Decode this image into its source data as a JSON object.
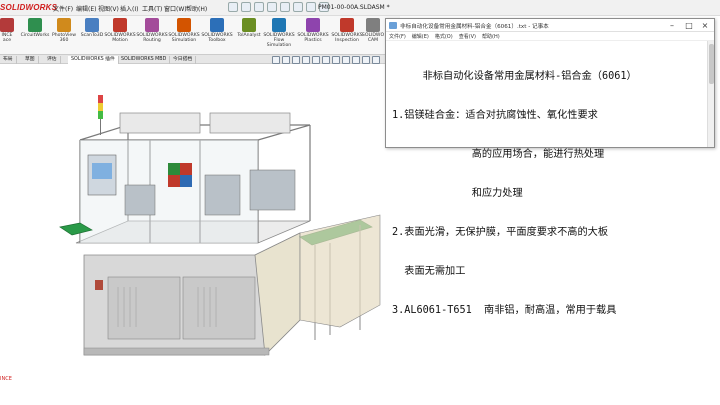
{
  "app": {
    "logo": "SOLIDWORKS",
    "document_title": "PM01-00-00A.SLDASM *"
  },
  "menu": [
    "文件(F)",
    "编辑(E)",
    "视图(V)",
    "插入(I)",
    "工具(T)",
    "窗口(W)",
    "帮助(H)"
  ],
  "tools": [
    {
      "label": "INCE\nace",
      "color": "#b33a3a"
    },
    {
      "label": "CircuitWorks",
      "color": "#2f8f4f"
    },
    {
      "label": "PhotoView\n360",
      "color": "#d08a1c"
    },
    {
      "label": "ScanTo3D",
      "color": "#4a7fc1"
    },
    {
      "label": "SOLIDWORKS\nMotion",
      "color": "#c0392b"
    },
    {
      "label": "SOLIDWORKS\nRouting",
      "color": "#a34b9a"
    },
    {
      "label": "SOLIDWORKS\nSimulation",
      "color": "#d35400"
    },
    {
      "label": "SOLIDWORKS\nToolbox",
      "color": "#2c6fb8"
    },
    {
      "label": "TolAnalyst",
      "color": "#6b8e23"
    },
    {
      "label": "SOLIDWORKS\nFlow\nSimulation",
      "color": "#1f77b4"
    },
    {
      "label": "SOLIDWORKS\nPlastics",
      "color": "#8e44ad"
    },
    {
      "label": "SOLIDWORKS\nInspection",
      "color": "#c0392b"
    },
    {
      "label": "SOLIDWO\nCAM",
      "color": "#7f7f7f"
    }
  ],
  "tabs": [
    "布局",
    "草图",
    "评估",
    "SOLIDWORKS 插件",
    "SOLIDWORKS MBD",
    "今日搭档"
  ],
  "notepad": {
    "title": "非标自动化设备常用金属材料-铝合金（6061）.txt - 记事本",
    "menu": [
      "文件(F)",
      "编辑(E)",
      "格式(O)",
      "查看(V)",
      "帮助(H)"
    ],
    "lines": [
      "     非标自动化设备常用金属材料-铝合金（6061）",
      "1.铝镁硅合金：适合对抗腐蚀性、氧化性要求",
      "             高的应用场合，能进行热处理",
      "             和应力处理",
      "2.表面光滑，无保护膜，平面度要求不高的大板",
      "  表面无需加工",
      "3.AL6061-T651  南非铝，耐高温，常用于载具"
    ]
  },
  "canvas": {
    "corner_mark": "INCE"
  }
}
